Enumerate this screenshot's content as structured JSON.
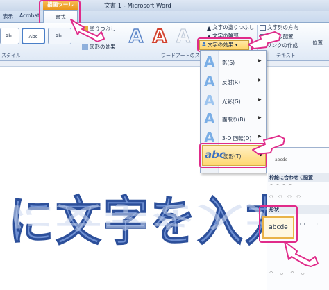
{
  "titlebar": {
    "document_title": "文書 1 - Microsoft Word",
    "contextual_tab": "描画ツール"
  },
  "tabs": {
    "display": "表示",
    "acrobat": "Acrobat",
    "format": "書式"
  },
  "ribbon": {
    "style_group_label": "スタイル",
    "style_sample": "Abc",
    "fill_label": "塗りつぶし",
    "effects_label": "図形の効果",
    "wordart_group_label": "ワードアートのスタイル",
    "text_fill": "文字の塗りつぶし",
    "text_outline": "文字の輪郭",
    "text_effects": "文字の効果",
    "text_direction": "文字列の方向",
    "text_align": "文字の配置",
    "create_link": "リンクの作成",
    "text_group_label": "テキスト",
    "position_label": "位置"
  },
  "menu": {
    "items": [
      {
        "label": "影(S)"
      },
      {
        "label": "反射(R)"
      },
      {
        "label": "光彩(G)"
      },
      {
        "label": "面取り(B)"
      },
      {
        "label": "3-D 回転(D)"
      },
      {
        "label": "変形(T)"
      }
    ]
  },
  "submenu": {
    "no_transform_sample": "abcde",
    "follow_path_head": "枠線に合わせて配置",
    "warp_head": "形状",
    "selected_sample": "abcde"
  },
  "document": {
    "wordart_text": "に文字を入力"
  },
  "colors": {
    "highlight": "#e02b8a",
    "wordart_fill": "#6e8fd2"
  }
}
